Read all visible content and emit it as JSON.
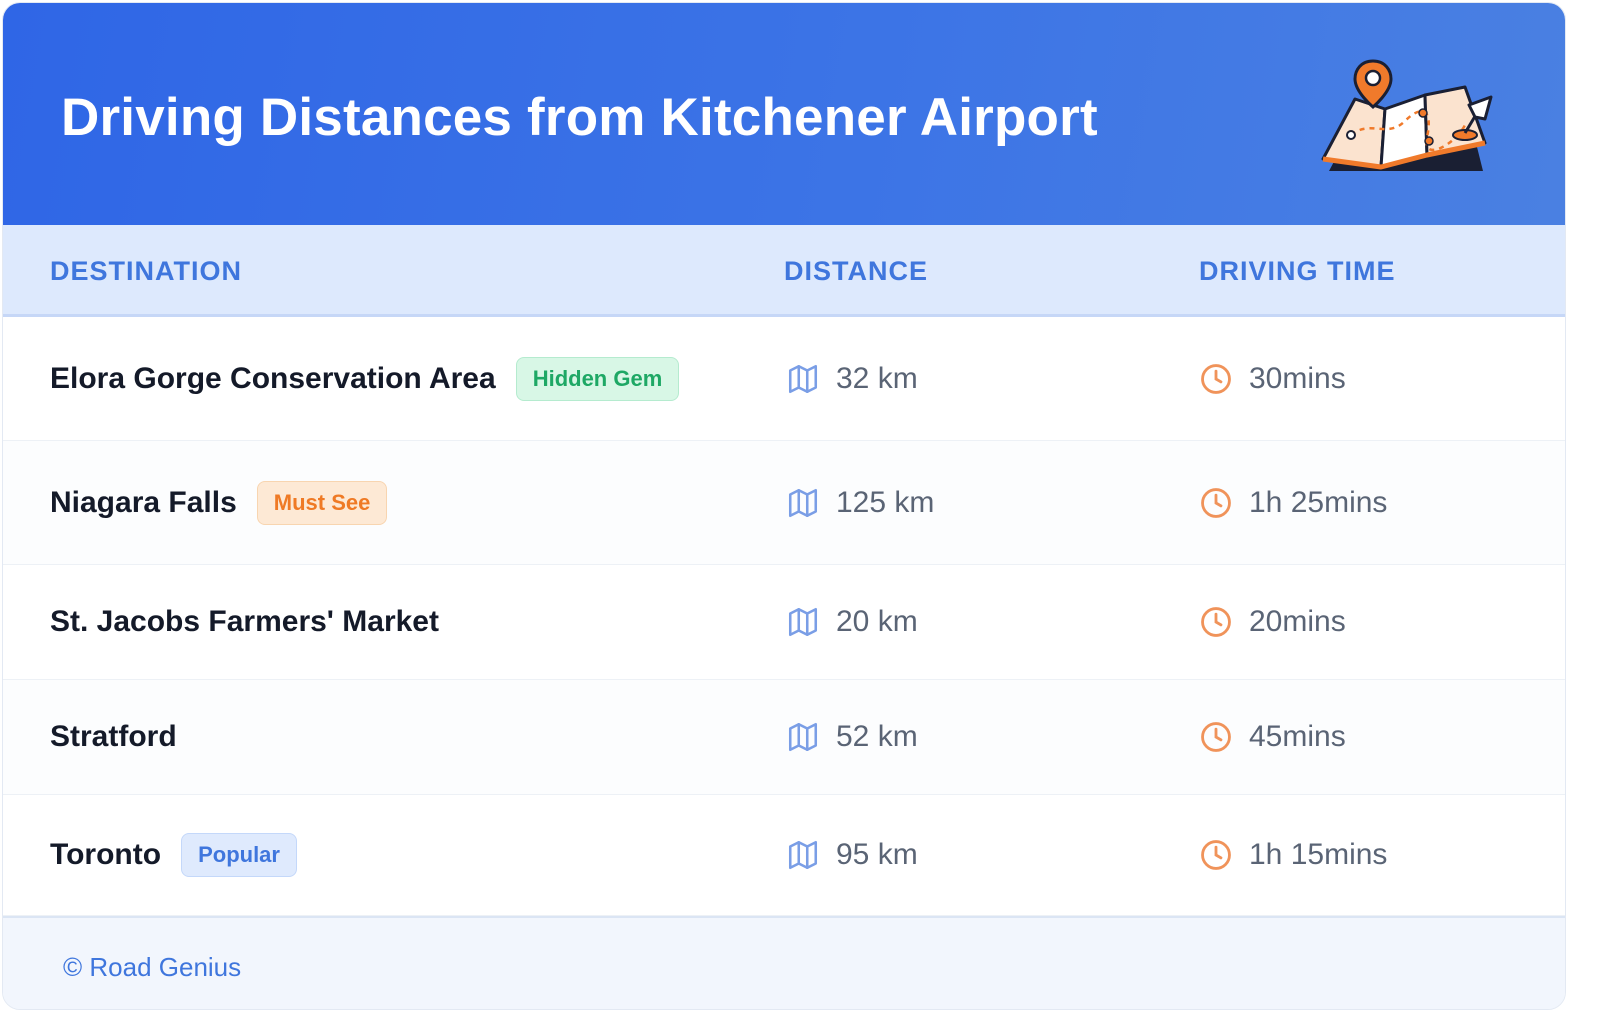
{
  "header": {
    "title": "Driving Distances from Kitchener Airport",
    "illustration_icon": "folded-map-with-pins-icon",
    "gradient_colors": [
      "#2f66e6",
      "#4a80e2"
    ]
  },
  "table": {
    "columns": [
      "DESTINATION",
      "DISTANCE",
      "DRIVING TIME"
    ],
    "rows": [
      {
        "destination": "Elora Gorge Conservation Area",
        "badge": "Hidden Gem",
        "badge_color": "#1ea865",
        "distance": "32 km",
        "time": "30mins"
      },
      {
        "destination": "Niagara Falls",
        "badge": "Must See",
        "badge_color": "#ef7a25",
        "distance": "125 km",
        "time": "1h 25mins"
      },
      {
        "destination": "St. Jacobs Farmers' Market",
        "badge": "",
        "badge_color": "",
        "distance": "20 km",
        "time": "20mins"
      },
      {
        "destination": "Stratford",
        "badge": "",
        "badge_color": "",
        "distance": "52 km",
        "time": "45mins"
      },
      {
        "destination": "Toronto",
        "badge": "Popular",
        "badge_color": "#3f76dd",
        "distance": "95 km",
        "time": "1h 15mins"
      }
    ],
    "distance_icon": "map-icon",
    "time_icon": "clock-icon",
    "distance_icon_color": "#7a9ee6",
    "time_icon_color": "#f0935a"
  },
  "footer": {
    "text": "© Road Genius"
  }
}
